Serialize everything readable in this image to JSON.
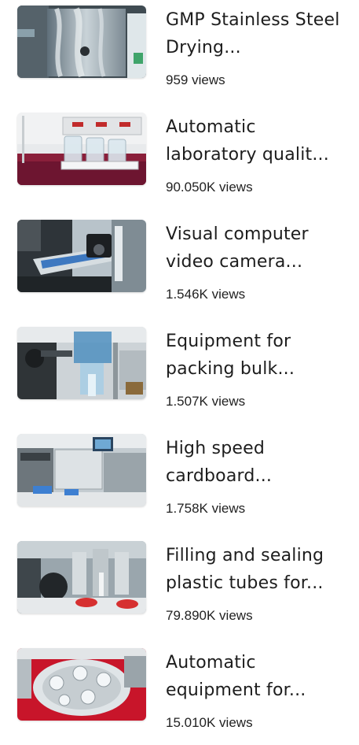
{
  "videos": [
    {
      "title": "GMP Stainless Steel Drying...",
      "views": "959 views",
      "thumbnail": "drying-machine-thumbnail"
    },
    {
      "title": "Automatic laboratory qualit...",
      "views": "90.050K views",
      "thumbnail": "laboratory-tester-thumbnail"
    },
    {
      "title": "Visual computer video camera...",
      "views": "1.546K views",
      "thumbnail": "vision-inspection-thumbnail"
    },
    {
      "title": "Equipment for packing bulk...",
      "views": "1.507K views",
      "thumbnail": "packing-machine-thumbnail"
    },
    {
      "title": "High speed cardboard...",
      "views": "1.758K views",
      "thumbnail": "cardboard-machine-thumbnail"
    },
    {
      "title": "Filling and sealing plastic tubes for...",
      "views": "79.890K views",
      "thumbnail": "tube-filling-thumbnail"
    },
    {
      "title": "Automatic equipment for...",
      "views": "15.010K views",
      "thumbnail": "rotary-filler-thumbnail"
    }
  ]
}
